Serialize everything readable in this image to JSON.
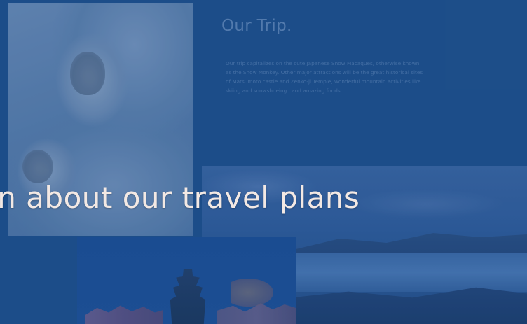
{
  "section": {
    "title": "Our Trip.",
    "body": "Our trip capitalizes on the cute Japanese Snow Macaques, otherwise known as the Snow Monkey. Other major attractions will be the great historical sites of Matsumoto castle and Zenko-ji Temple, wonderful mountain activities like skiing and snowshoeing , and amazing foods."
  },
  "caption": "on about our travel plans",
  "colors": {
    "background": "#1d4e89",
    "caption_text": "#f3e9e4",
    "title_text": "#5f84b5",
    "body_text": "#4d76aa"
  },
  "images": {
    "left": "snow-monkeys-photo",
    "right": "lake-landscape-photo",
    "bottom": "matsumoto-castle-photo"
  }
}
